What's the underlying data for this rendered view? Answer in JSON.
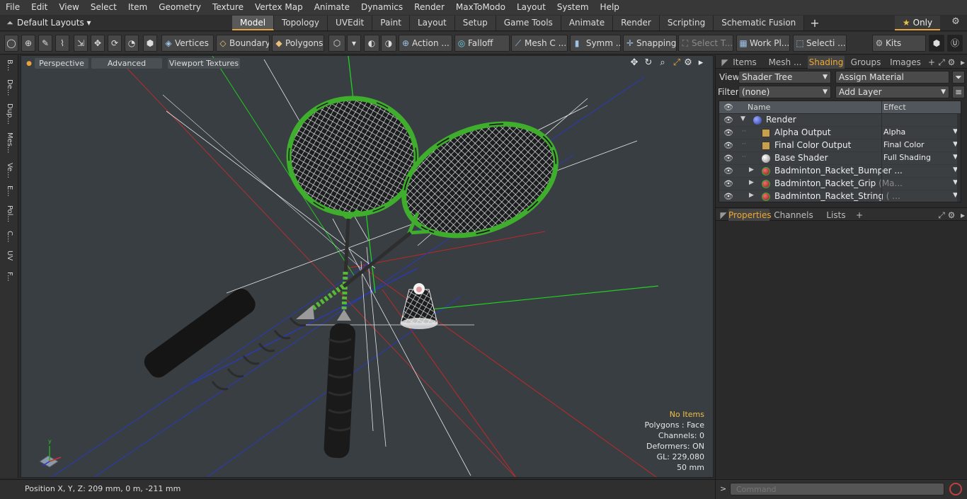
{
  "menubar": [
    "File",
    "Edit",
    "View",
    "Select",
    "Item",
    "Geometry",
    "Texture",
    "Vertex Map",
    "Animate",
    "Dynamics",
    "Render",
    "MaxToModo",
    "Layout",
    "System",
    "Help"
  ],
  "layout_select": "Default Layouts",
  "layout_tabs": [
    "Model",
    "Topology",
    "UVEdit",
    "Paint",
    "Layout",
    "Setup",
    "Game Tools",
    "Animate",
    "Render",
    "Scripting",
    "Schematic Fusion"
  ],
  "active_tab": "Model",
  "only_label": "Only",
  "toolbar": {
    "vertices": "Vertices",
    "boundary": "Boundary",
    "polygons": "Polygons",
    "action": "Action ...",
    "falloff": "Falloff",
    "mesh": "Mesh C ...",
    "symm": "Symm ...",
    "snapping": "Snapping",
    "select_t": "Select T...",
    "work_pl": "Work Pl...",
    "selecti": "Selecti ...",
    "kits": "Kits"
  },
  "left_tabs": [
    "B...",
    "De...",
    "Dup...",
    "Mes...",
    "Ve...",
    "E...",
    "Pol...",
    "C...",
    "UV",
    "F..."
  ],
  "viewport": {
    "perspective": "Perspective",
    "advanced": "Advanced",
    "textures": "Viewport Textures",
    "hud": {
      "no_items": "No Items",
      "polygons": "Polygons : Face",
      "channels": "Channels: 0",
      "deformers": "Deformers: ON",
      "gl": "GL: 229,080",
      "scale": "50 mm"
    }
  },
  "status": {
    "position": "Position X, Y, Z:   209 mm, 0 m, -211 mm"
  },
  "right_tabs": [
    "Items",
    "Mesh ...",
    "Shading",
    "Groups",
    "Images"
  ],
  "right_active": "Shading",
  "view_label": "View",
  "view_value": "Shader Tree",
  "assign_material": "Assign Material",
  "filter_label": "Filter",
  "filter_value": "(none)",
  "add_layer": "Add Layer",
  "shader_tree": {
    "col_name": "Name",
    "col_effect": "Effect",
    "rows": [
      {
        "name": "Render",
        "effect": "",
        "indent": 0,
        "kind": "render"
      },
      {
        "name": "Alpha Output",
        "effect": "Alpha",
        "indent": 1,
        "kind": "output"
      },
      {
        "name": "Final Color Output",
        "effect": "Final Color",
        "indent": 1,
        "kind": "output"
      },
      {
        "name": "Base Shader",
        "effect": "Full Shading",
        "indent": 1,
        "kind": "shader"
      },
      {
        "name": "Badminton_Racket_Bumper ...",
        "effect": "",
        "indent": 1,
        "kind": "material"
      },
      {
        "name": "Badminton_Racket_Grip",
        "suffix": "(Ma...",
        "effect": "",
        "indent": 1,
        "kind": "material"
      },
      {
        "name": "Badminton_Racket_String",
        "suffix": "( ...",
        "effect": "",
        "indent": 1,
        "kind": "material"
      }
    ]
  },
  "props_tabs": [
    "Properties",
    "Channels",
    "Lists"
  ],
  "props_active": "Properties",
  "command_placeholder": "Command",
  "colors": {
    "accent": "#e8a33a",
    "green_frame": "#3fae2c",
    "viewport_bg": "#383e42"
  }
}
